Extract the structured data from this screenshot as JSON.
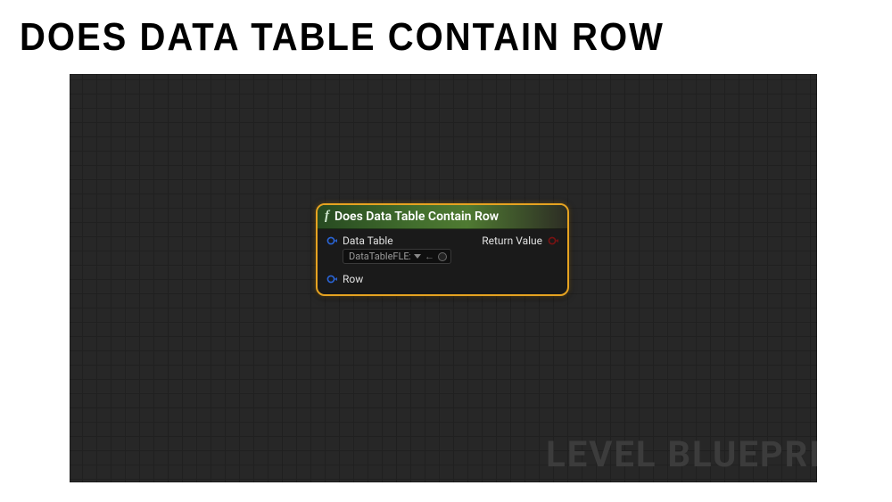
{
  "page": {
    "title": "DOES DATA TABLE CONTAIN ROW"
  },
  "graph": {
    "watermark": "LEVEL BLUEPRI"
  },
  "node": {
    "title": "Does Data Table Contain Row",
    "inputs": {
      "data_table": {
        "label": "Data Table",
        "default_value": "DataTableFLExam",
        "pin_color": "#1e90ff"
      },
      "row": {
        "label": "Row",
        "pin_color": "#1e90ff"
      }
    },
    "outputs": {
      "return_value": {
        "label": "Return Value",
        "pin_color": "#8a0d0d"
      }
    }
  }
}
